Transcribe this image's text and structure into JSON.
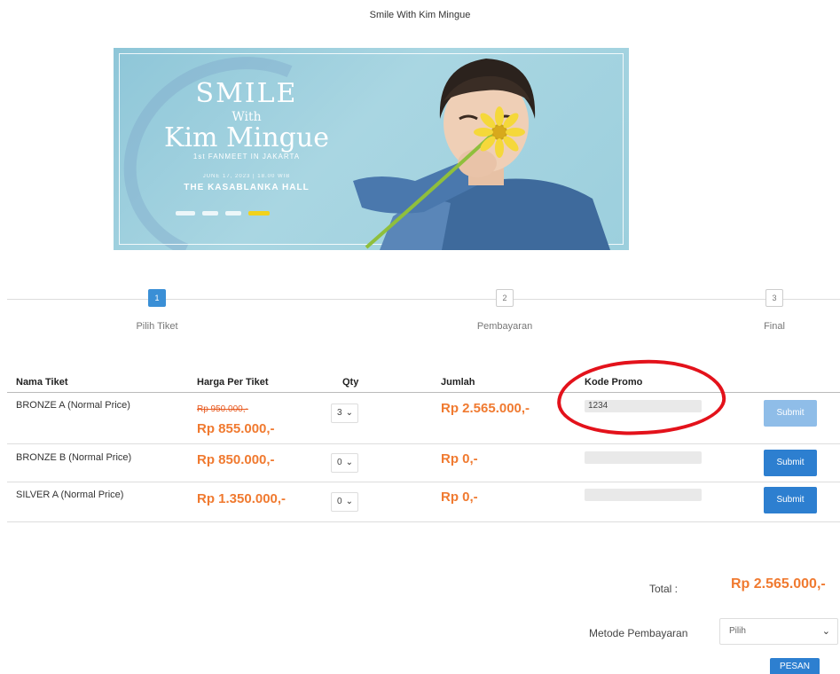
{
  "page": {
    "title": "Smile With Kim Mingue"
  },
  "banner": {
    "line1": "SMILE",
    "line2": "With",
    "line3": "Kim Mingue",
    "subtitle": "1st FANMEET IN JAKARTA",
    "date": "JUNE 17, 2023 | 18.00 WIB",
    "venue": "THE KASABLANKA HALL"
  },
  "stepper": {
    "steps": [
      {
        "number": "1",
        "label": "Pilih Tiket"
      },
      {
        "number": "2",
        "label": "Pembayaran"
      },
      {
        "number": "3",
        "label": "Final"
      }
    ]
  },
  "table": {
    "headers": {
      "name": "Nama Tiket",
      "price": "Harga Per Tiket",
      "qty": "Qty",
      "total": "Jumlah",
      "promo": "Kode Promo"
    },
    "rows": [
      {
        "name": "BRONZE A (Normal Price)",
        "original_price": "Rp 950.000,-",
        "price": "Rp 855.000,-",
        "qty": "3",
        "total": "Rp 2.565.000,-",
        "promo_value": "1234",
        "submit_label": "Submit"
      },
      {
        "name": "BRONZE B (Normal Price)",
        "price": "Rp 850.000,-",
        "qty": "0",
        "total": "Rp 0,-",
        "promo_value": "",
        "submit_label": "Submit"
      },
      {
        "name": "SILVER A (Normal Price)",
        "price": "Rp 1.350.000,-",
        "qty": "0",
        "total": "Rp 0,-",
        "promo_value": "",
        "submit_label": "Submit"
      }
    ]
  },
  "summary": {
    "total_label": "Total :",
    "total_value": "Rp 2.565.000,-",
    "method_label": "Metode Pembayaran",
    "method_selected": "Pilih",
    "order_button": "PESAN"
  },
  "colors": {
    "accent_blue": "#2d7fd0",
    "price_orange": "#f07a30",
    "annotation_red": "#e3121b"
  }
}
